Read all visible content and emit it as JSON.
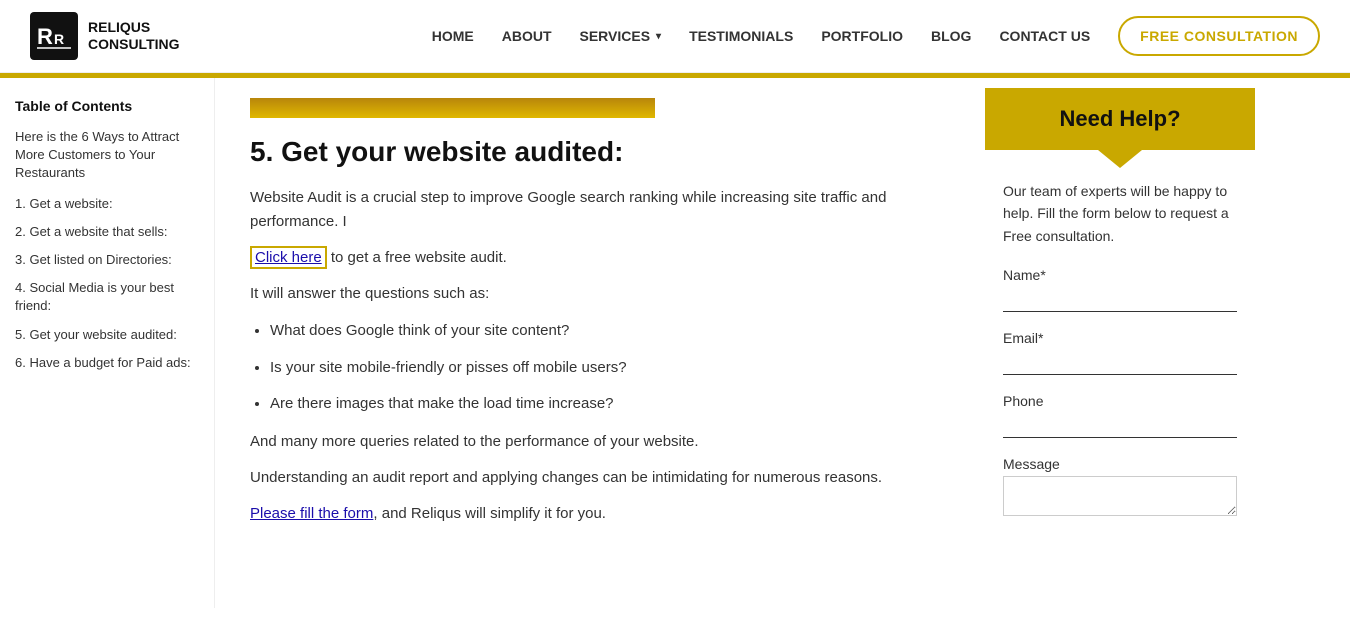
{
  "header": {
    "logo_line1": "RELIQUS",
    "logo_line2": "CONSULTING",
    "nav": {
      "home": "HOME",
      "about": "ABOUT",
      "services": "SERVICES",
      "testimonials": "TESTIMONIALS",
      "portfolio": "PORTFOLIO",
      "blog": "BLOG",
      "contact_us": "CONTACT US"
    },
    "cta_button": "FREE CONSULTATION"
  },
  "sidebar": {
    "toc_title": "Table of Contents",
    "toc_intro": "Here is the 6 Ways to Attract More Customers to Your Restaurants",
    "items": [
      "1. Get a website:",
      "2. Get a website that sells:",
      "3. Get listed on Directories:",
      "4. Social Media is your best friend:",
      "5. Get your website audited:",
      "6. Have a budget for Paid ads:"
    ]
  },
  "main": {
    "section_heading": "5. Get your website audited:",
    "paragraph1": "Website Audit is a crucial step to improve Google search ranking while increasing site traffic and performance. I",
    "click_here_text": "Click here",
    "after_click": " to get a free website audit.",
    "paragraph2": "It will answer the questions such as:",
    "bullet_items": [
      "What does Google think of your site content?",
      "Is your site mobile-friendly or pisses off mobile users?",
      "Are there images that make the load time increase?"
    ],
    "paragraph3": "And many more queries related to the performance of your website.",
    "paragraph4_before": "Understanding an audit report and applying changes can be intimidating for numerous reasons.",
    "please_link": "Please fill the form",
    "paragraph4_after": ", and Reliqus will simplify it for you."
  },
  "right_sidebar": {
    "heading": "Need Help?",
    "description": "Our team of experts will be happy to help. Fill the form below to request a Free consultation.",
    "form": {
      "name_label": "Name*",
      "email_label": "Email*",
      "phone_label": "Phone",
      "message_label": "Message",
      "name_placeholder": "",
      "email_placeholder": "",
      "phone_placeholder": "",
      "message_placeholder": ""
    }
  }
}
